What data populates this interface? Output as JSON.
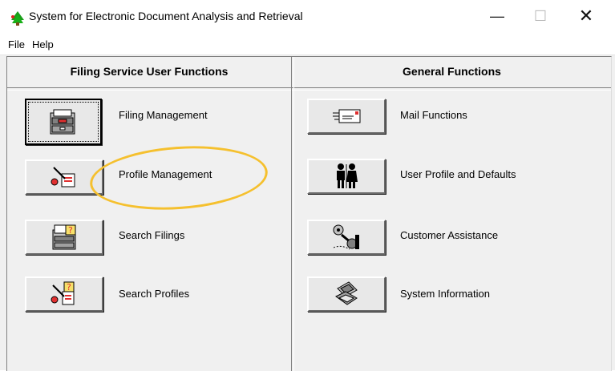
{
  "window": {
    "title": "System for Electronic Document Analysis and Retrieval"
  },
  "titlebar_controls": {
    "minimize": "—",
    "maximize": "☐",
    "close": "✕"
  },
  "menu": {
    "items": [
      "File",
      "Help"
    ]
  },
  "sections": {
    "left_title": "Filing Service User Functions",
    "right_title": "General Functions"
  },
  "left_functions": [
    {
      "label": "Filing Management",
      "icon": "file-cabinet-icon"
    },
    {
      "label": "Profile Management",
      "icon": "profile-quill-icon"
    },
    {
      "label": "Search Filings",
      "icon": "search-cabinet-icon"
    },
    {
      "label": "Search Profiles",
      "icon": "search-profile-icon"
    }
  ],
  "right_functions": [
    {
      "label": "Mail Functions",
      "icon": "mail-envelope-icon"
    },
    {
      "label": "User Profile and Defaults",
      "icon": "people-icon"
    },
    {
      "label": "Customer Assistance",
      "icon": "telephone-icon"
    },
    {
      "label": "System Information",
      "icon": "computer-icon"
    }
  ],
  "colors": {
    "annotation": "#f5c02e",
    "app_icon": "#1a9e1a"
  }
}
